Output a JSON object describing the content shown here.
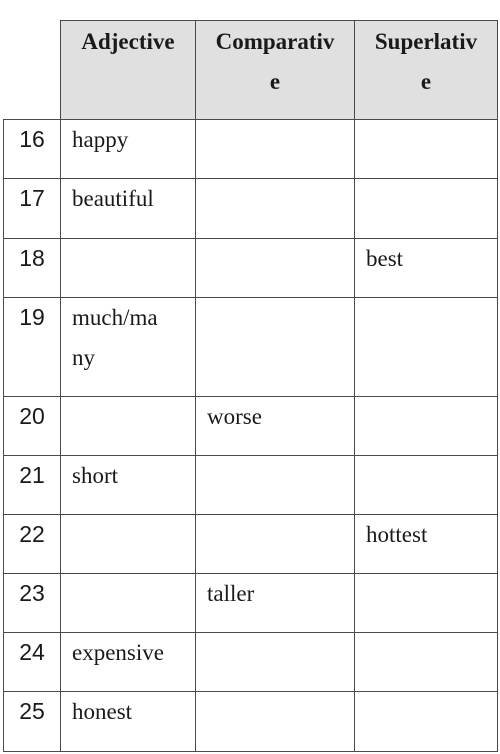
{
  "table": {
    "headers": [
      "Adjective",
      "Comparativ\ne",
      "Superlativ\ne"
    ],
    "header_lines": [
      [
        "Adjective"
      ],
      [
        "Comparativ",
        "e"
      ],
      [
        "Superlativ",
        "e"
      ]
    ],
    "rows": [
      {
        "number": "16",
        "adjective": "happy",
        "comparative": "",
        "superlative": ""
      },
      {
        "number": "17",
        "adjective": "beautiful",
        "comparative": "",
        "superlative": ""
      },
      {
        "number": "18",
        "adjective": "",
        "comparative": "",
        "superlative": "best"
      },
      {
        "number": "19",
        "adjective": "much/ma\nny",
        "comparative": "",
        "superlative": ""
      },
      {
        "number": "20",
        "adjective": "",
        "comparative": "worse",
        "superlative": ""
      },
      {
        "number": "21",
        "adjective": "short",
        "comparative": "",
        "superlative": ""
      },
      {
        "number": "22",
        "adjective": "",
        "comparative": "",
        "superlative": "hottest"
      },
      {
        "number": "23",
        "adjective": "",
        "comparative": "taller",
        "superlative": ""
      },
      {
        "number": "24",
        "adjective": "expensive",
        "comparative": "",
        "superlative": ""
      },
      {
        "number": "25",
        "adjective": "honest",
        "comparative": "",
        "superlative": ""
      }
    ]
  },
  "colors": {
    "header_bg": "#e0e0e0",
    "border": "#4a4a4a"
  }
}
